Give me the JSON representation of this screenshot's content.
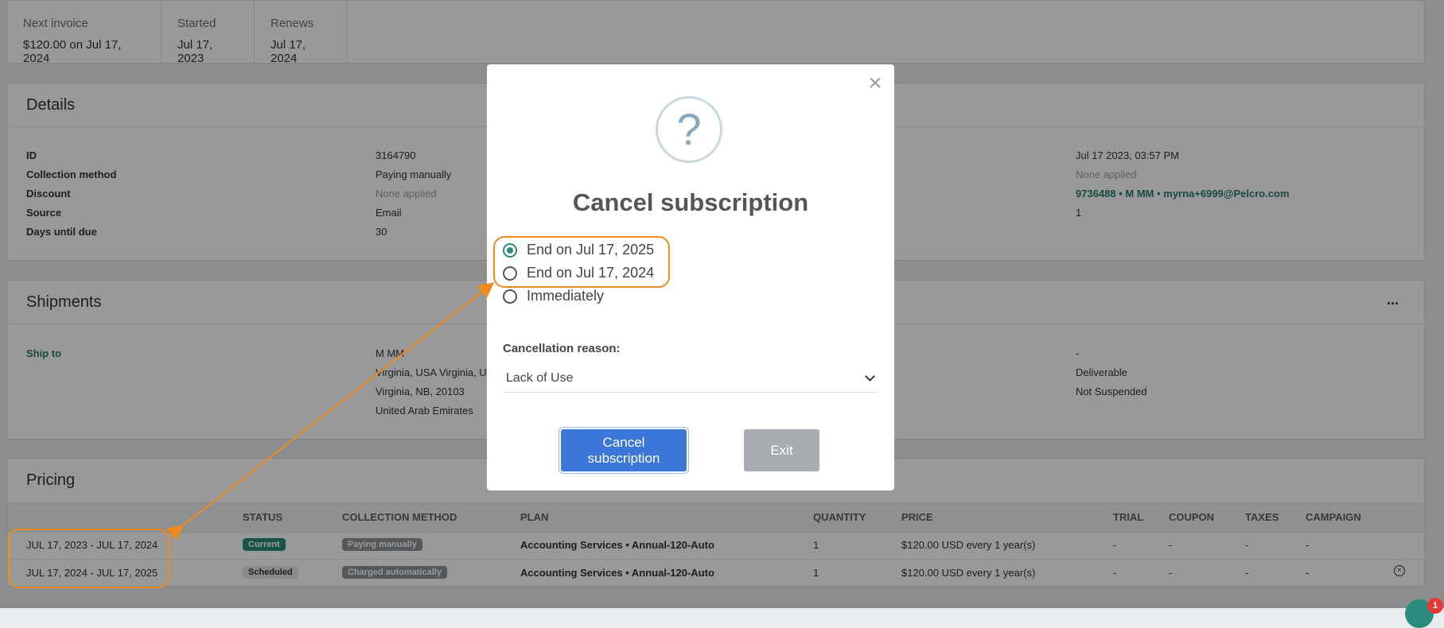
{
  "summary": {
    "items": [
      {
        "label": "Next invoice",
        "value": "$120.00 on Jul 17, 2024"
      },
      {
        "label": "Started",
        "value": "Jul 17, 2023"
      },
      {
        "label": "Renews",
        "value": "Jul 17, 2024"
      }
    ]
  },
  "details": {
    "title": "Details",
    "left_labels": [
      "ID",
      "Collection method",
      "Discount",
      "Source",
      "Days until due"
    ],
    "left_values": [
      "3164790",
      "Paying manually",
      "None applied",
      "Email",
      "30"
    ],
    "right_values": [
      "Jul 17 2023, 03:57 PM",
      "None applied",
      "9736488 • M MM • myrna+6999@Pelcro.com",
      "1"
    ]
  },
  "shipments": {
    "title": "Shipments",
    "more_icon": "...",
    "ship_to_label": "Ship to",
    "address_lines": [
      "M MM",
      "Virginia, USA Virginia, US",
      "Virginia, NB, 20103",
      "United Arab Emirates"
    ],
    "right_values": [
      "-",
      "Deliverable",
      "Not Suspended"
    ]
  },
  "pricing": {
    "title": "Pricing",
    "columns": [
      "STATUS",
      "COLLECTION METHOD",
      "PLAN",
      "QUANTITY",
      "PRICE",
      "TRIAL",
      "COUPON",
      "TAXES",
      "CAMPAIGN"
    ],
    "rows": [
      {
        "period": "JUL 17, 2023 - JUL 17, 2024",
        "status": "Current",
        "method": "Paying manually",
        "plan": "Accounting Services • Annual-120-Auto",
        "quantity": "1",
        "price": "$120.00 USD every 1 year(s)",
        "trial": "-",
        "coupon": "-",
        "taxes": "-",
        "campaign": "-"
      },
      {
        "period": "JUL 17, 2024 - JUL 17, 2025",
        "status": "Scheduled",
        "method": "Charged automatically",
        "plan": "Accounting Services • Annual-120-Auto",
        "quantity": "1",
        "price": "$120.00 USD every 1 year(s)",
        "trial": "-",
        "coupon": "-",
        "taxes": "-",
        "campaign": "-"
      }
    ]
  },
  "modal": {
    "close_icon": "×",
    "question_icon": "?",
    "title": "Cancel subscription",
    "options": [
      "End on Jul 17, 2025",
      "End on Jul 17, 2024",
      "Immediately"
    ],
    "selected_option": "End on Jul 17, 2025",
    "reason_label": "Cancellation reason:",
    "reason_value": "Lack of Use",
    "confirm_button": "Cancel subscription",
    "exit_button": "Exit"
  },
  "chat": {
    "badge": "1"
  },
  "colors": {
    "accent": "#2a8c7c",
    "primary_button": "#3b76d8",
    "annotation": "#f08a1c"
  }
}
